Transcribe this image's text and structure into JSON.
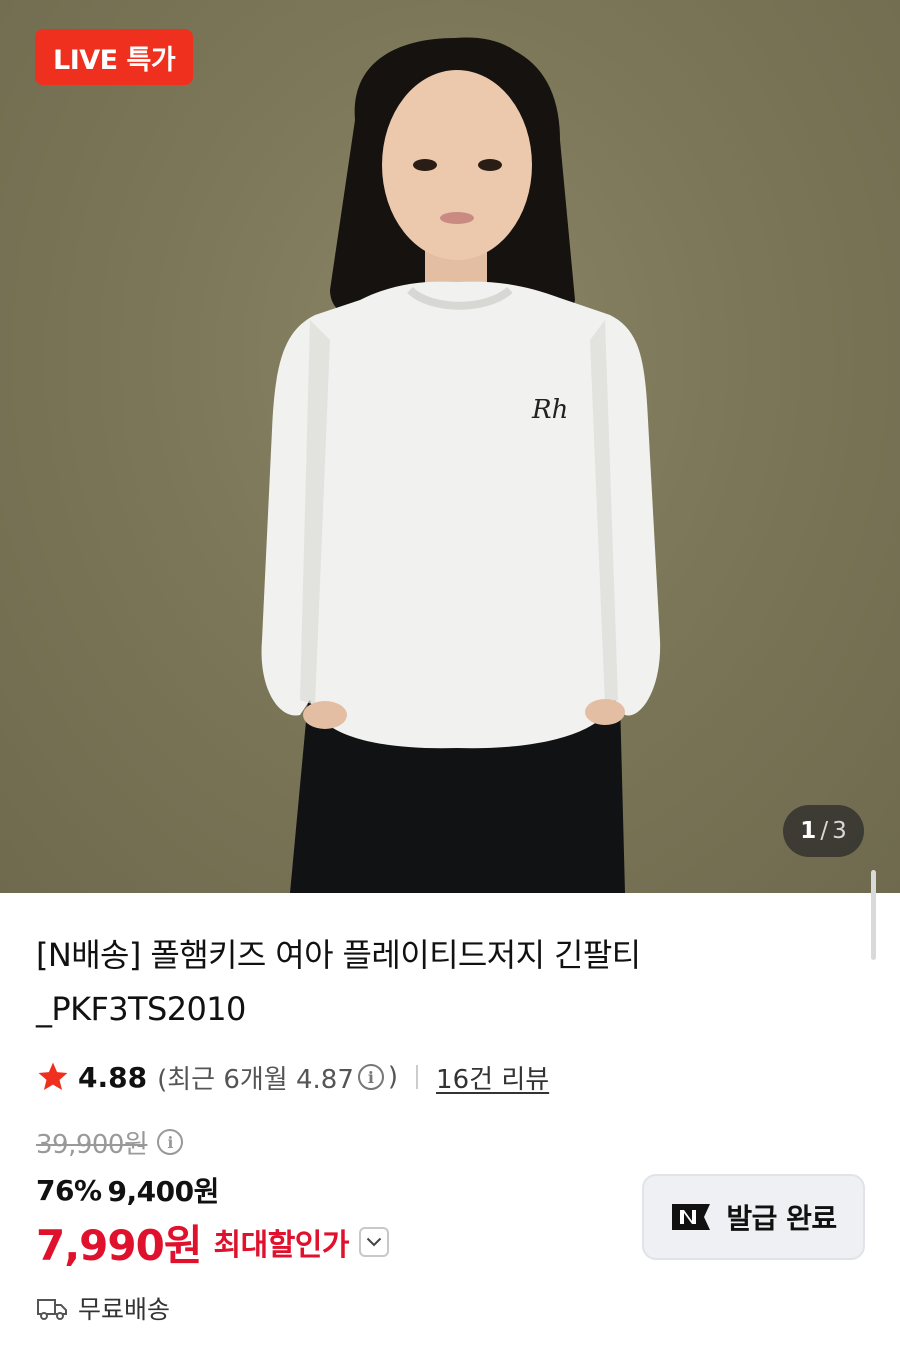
{
  "hero": {
    "badge_label": "LIVE 특가",
    "counter_current": "1",
    "counter_separator": "/",
    "counter_total": "3",
    "image_count": 3,
    "current_index": 1
  },
  "product": {
    "title": "[N배송] 폴햄키즈 여아 플레이티드저지 긴팔티 _PKF3TS2010"
  },
  "rating": {
    "score": "4.88",
    "recent_prefix": "(최근 6개월 4.87",
    "recent_suffix": ")",
    "review_link": "16건 리뷰"
  },
  "price": {
    "original": "39,900원",
    "discount_percent": "76%",
    "sale_price": "9,400원",
    "final_price": "7,990원",
    "final_label": "최대할인가"
  },
  "coupon": {
    "label": "발급 완료"
  },
  "shipping": {
    "label": "무료배송"
  },
  "colors": {
    "live_badge": "#f0301e",
    "final_price": "#e0112c",
    "star": "#f0301e",
    "background_backdrop": "#7d7759"
  },
  "icons": {
    "star": "star-icon",
    "info": "info-icon",
    "chevron": "chevron-down-icon",
    "naver_n": "naver-n-icon",
    "truck": "truck-icon"
  }
}
